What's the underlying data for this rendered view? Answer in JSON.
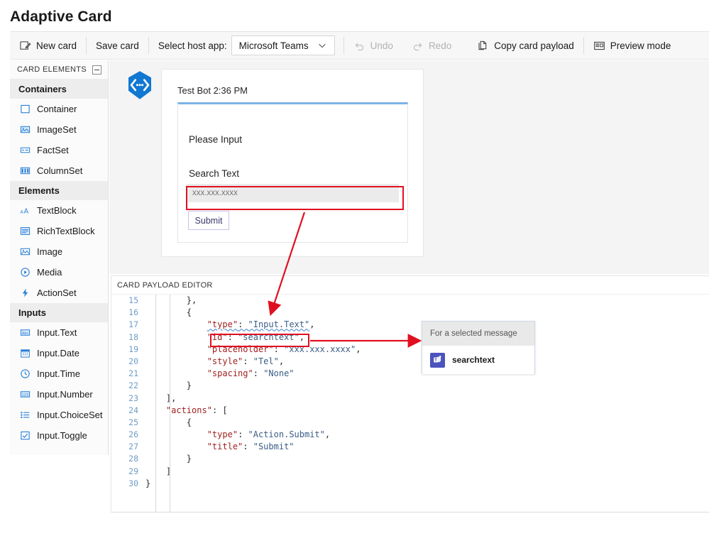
{
  "page": {
    "title": "Adaptive Card"
  },
  "toolbar": {
    "new_card": "New card",
    "save_card": "Save card",
    "host_app_label": "Select host app:",
    "host_app_value": "Microsoft Teams",
    "undo": "Undo",
    "redo": "Redo",
    "copy_payload": "Copy card payload",
    "preview_mode": "Preview mode"
  },
  "sidebar": {
    "header": "CARD ELEMENTS",
    "groups": [
      {
        "label": "Containers",
        "items": [
          {
            "label": "Container",
            "icon": "container-icon"
          },
          {
            "label": "ImageSet",
            "icon": "imageset-icon"
          },
          {
            "label": "FactSet",
            "icon": "factset-icon"
          },
          {
            "label": "ColumnSet",
            "icon": "columnset-icon"
          }
        ]
      },
      {
        "label": "Elements",
        "items": [
          {
            "label": "TextBlock",
            "icon": "textblock-icon"
          },
          {
            "label": "RichTextBlock",
            "icon": "richtextblock-icon"
          },
          {
            "label": "Image",
            "icon": "image-icon"
          },
          {
            "label": "Media",
            "icon": "media-icon"
          },
          {
            "label": "ActionSet",
            "icon": "actionset-icon"
          }
        ]
      },
      {
        "label": "Inputs",
        "items": [
          {
            "label": "Input.Text",
            "icon": "input-text-icon"
          },
          {
            "label": "Input.Date",
            "icon": "input-date-icon"
          },
          {
            "label": "Input.Time",
            "icon": "input-time-icon"
          },
          {
            "label": "Input.Number",
            "icon": "input-number-icon"
          },
          {
            "label": "Input.ChoiceSet",
            "icon": "input-choiceset-icon"
          },
          {
            "label": "Input.Toggle",
            "icon": "input-toggle-icon"
          }
        ]
      }
    ]
  },
  "preview": {
    "bot_name": "Test Bot 2:36 PM",
    "card_title": "Please Input",
    "input_label": "Search Text",
    "input_placeholder": "xxx.xxx.xxxx",
    "input_value": "",
    "submit_label": "Submit"
  },
  "payload_editor": {
    "header": "CARD PAYLOAD EDITOR",
    "lines": [
      {
        "n": "15",
        "segments": [
          {
            "t": "        },",
            "c": "p"
          }
        ]
      },
      {
        "n": "16",
        "segments": [
          {
            "t": "        {",
            "c": "p"
          }
        ]
      },
      {
        "n": "17",
        "segments": [
          {
            "t": "            ",
            "c": "p"
          },
          {
            "t": "\"type\"",
            "c": "k wavy"
          },
          {
            "t": ": ",
            "c": "p wavy"
          },
          {
            "t": "\"Input.Text\"",
            "c": "s wavy"
          },
          {
            "t": ",",
            "c": "p"
          }
        ]
      },
      {
        "n": "18",
        "segments": [
          {
            "t": "            ",
            "c": "p"
          },
          {
            "t": "\"id\"",
            "c": "k"
          },
          {
            "t": ": ",
            "c": "p"
          },
          {
            "t": "\"searchtext\"",
            "c": "s"
          },
          {
            "t": ",",
            "c": "p"
          }
        ]
      },
      {
        "n": "19",
        "segments": [
          {
            "t": "            ",
            "c": "p"
          },
          {
            "t": "\"placeholder\"",
            "c": "k"
          },
          {
            "t": ": ",
            "c": "p"
          },
          {
            "t": "\"xxx.xxx.xxxx\"",
            "c": "s"
          },
          {
            "t": ",",
            "c": "p"
          }
        ]
      },
      {
        "n": "20",
        "segments": [
          {
            "t": "            ",
            "c": "p"
          },
          {
            "t": "\"style\"",
            "c": "k"
          },
          {
            "t": ": ",
            "c": "p"
          },
          {
            "t": "\"Tel\"",
            "c": "s"
          },
          {
            "t": ",",
            "c": "p"
          }
        ]
      },
      {
        "n": "21",
        "segments": [
          {
            "t": "            ",
            "c": "p"
          },
          {
            "t": "\"spacing\"",
            "c": "k"
          },
          {
            "t": ": ",
            "c": "p"
          },
          {
            "t": "\"None\"",
            "c": "s"
          }
        ]
      },
      {
        "n": "22",
        "segments": [
          {
            "t": "        }",
            "c": "p"
          }
        ]
      },
      {
        "n": "23",
        "segments": [
          {
            "t": "    ],",
            "c": "p"
          }
        ]
      },
      {
        "n": "24",
        "segments": [
          {
            "t": "    ",
            "c": "p"
          },
          {
            "t": "\"actions\"",
            "c": "k"
          },
          {
            "t": ": [",
            "c": "p"
          }
        ]
      },
      {
        "n": "25",
        "segments": [
          {
            "t": "        {",
            "c": "p"
          }
        ]
      },
      {
        "n": "26",
        "segments": [
          {
            "t": "            ",
            "c": "p"
          },
          {
            "t": "\"type\"",
            "c": "k"
          },
          {
            "t": ": ",
            "c": "p"
          },
          {
            "t": "\"Action.Submit\"",
            "c": "s"
          },
          {
            "t": ",",
            "c": "p"
          }
        ]
      },
      {
        "n": "27",
        "segments": [
          {
            "t": "            ",
            "c": "p"
          },
          {
            "t": "\"title\"",
            "c": "k"
          },
          {
            "t": ": ",
            "c": "p"
          },
          {
            "t": "\"Submit\"",
            "c": "s"
          }
        ]
      },
      {
        "n": "28",
        "segments": [
          {
            "t": "        }",
            "c": "p"
          }
        ]
      },
      {
        "n": "29",
        "segments": [
          {
            "t": "    ]",
            "c": "p"
          }
        ]
      },
      {
        "n": "30",
        "segments": [
          {
            "t": "}",
            "c": "p"
          }
        ]
      }
    ]
  },
  "flow_popup": {
    "header": "For a selected message",
    "item_label": "searchtext",
    "item_icon": "microsoft-teams-icon"
  },
  "annotations": {
    "highlight_color": "#e01020",
    "callouts": [
      "input-field-highlight",
      "json-id-highlight",
      "arrow-input-to-json",
      "arrow-json-to-flow"
    ]
  },
  "colors": {
    "accent_blue": "#0f77d2",
    "teams_purple": "#4b53bc",
    "annotation_red": "#e01020",
    "code_key": "#a02020",
    "code_string": "#3b5d87",
    "line_number": "#6e9dc6"
  }
}
